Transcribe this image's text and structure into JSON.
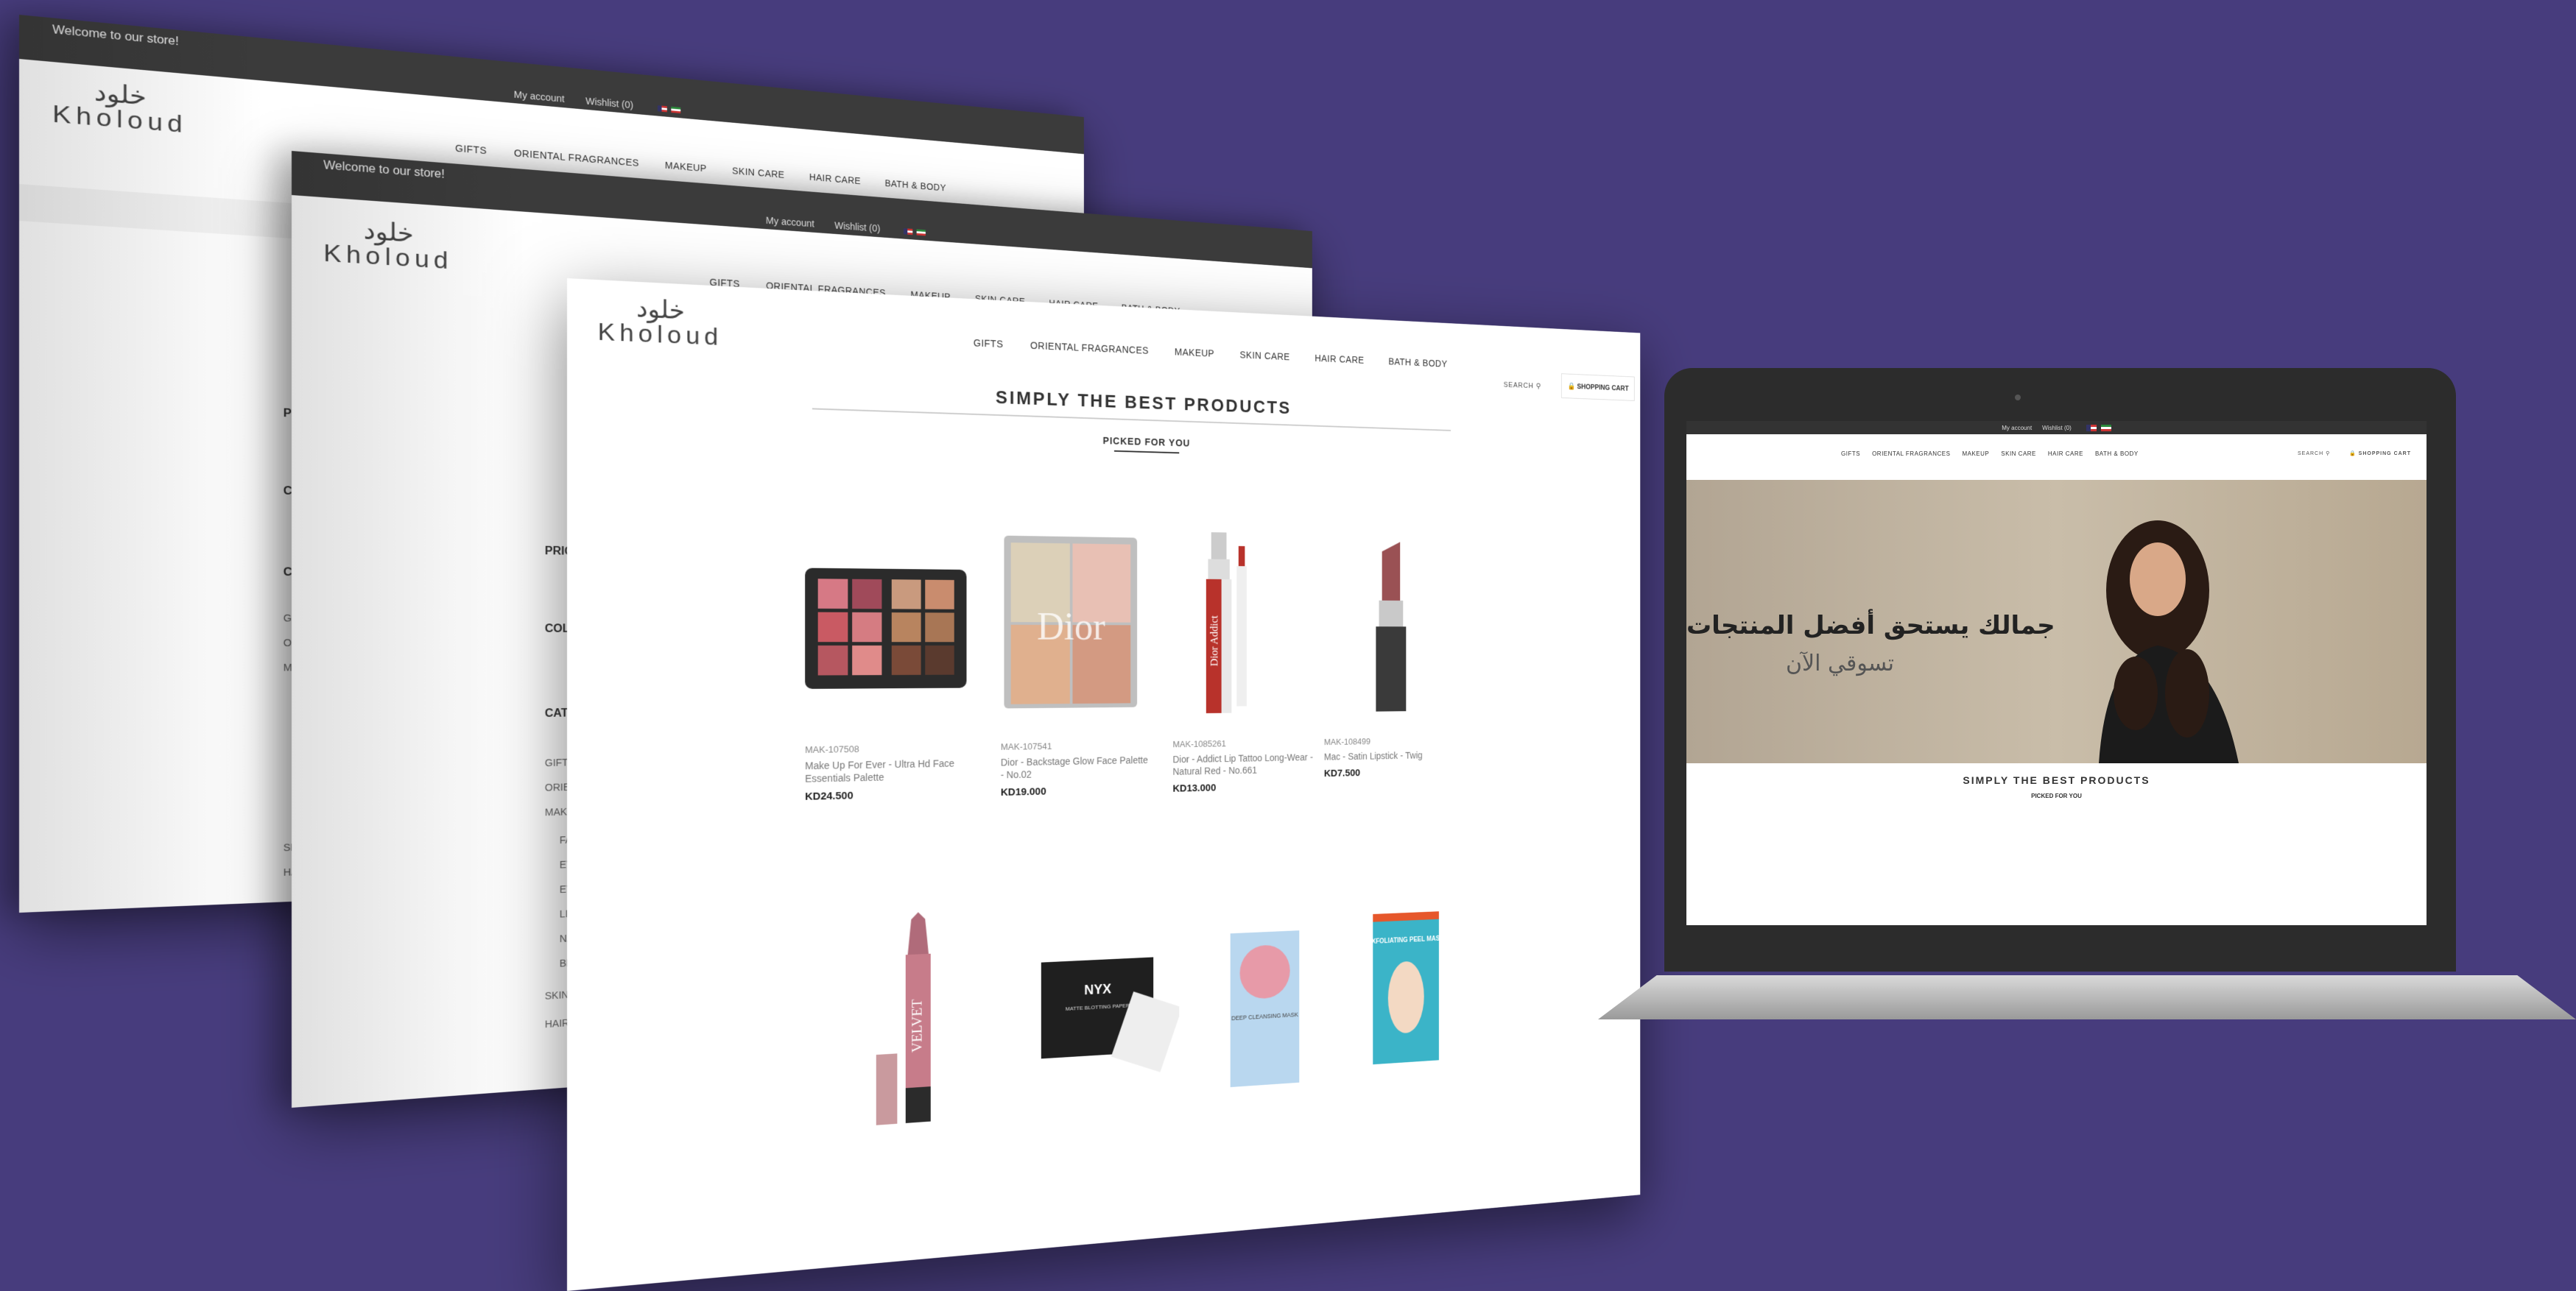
{
  "store": {
    "welcome": "Welcome to our store!",
    "my_account": "My account",
    "wishlist": "Wishlist (0)",
    "logo_ar": "خلود",
    "logo_en": "Kholoud",
    "search": "SEARCH",
    "cart": "SHOPPING CART"
  },
  "nav": [
    "GIFTS",
    "ORIENTAL FRAGRANCES",
    "MAKEUP",
    "SKIN CARE",
    "HAIR CARE",
    "BATH & BODY"
  ],
  "sidebar": {
    "price": "PRICE",
    "colour": "COLOU",
    "category": "CATEG",
    "items": [
      "GIFTS",
      "ORIENT",
      "MAKEU",
      "FAC",
      "EYE",
      "EYE",
      "LIPS",
      "NAI",
      "BRU",
      "SKIN C",
      "HAIR C"
    ]
  },
  "section": {
    "title": "SIMPLY THE BEST PRODUCTS",
    "subtitle": "PICKED FOR YOU"
  },
  "products": [
    {
      "sku": "MAK-107508",
      "name": "Make Up For Ever - Ultra Hd Face Essentials Palette",
      "price": "KD24.500"
    },
    {
      "sku": "MAK-107541",
      "name": "Dior - Backstage Glow Face Palette - No.02",
      "price": "KD19.000"
    },
    {
      "sku": "MAK-1085261",
      "name": "Dior - Addict Lip Tattoo Long-Wear - Natural Red - No.661",
      "price": "KD13.000"
    },
    {
      "sku": "MAK-108499",
      "name": "Mac - Satin Lipstick - Twig",
      "price": "KD7.500"
    }
  ],
  "product_labels": {
    "dior": "Dior",
    "dior_addict": "Dior Addict",
    "nyx": "NYX",
    "nyx_sub": "MATTE BLOTTING PAPER",
    "velvet": "VELVET",
    "peel": "EXFOLIATING PEEL MASK",
    "mask": "DEEP CLEANSING MASK"
  },
  "hero": {
    "headline_ar": "جمالك يستحق أفضل المنتجات",
    "sub_ar": "تسوقي الآن"
  },
  "colors": {
    "background": "#473c7d",
    "topbar": "#3b3b3b"
  }
}
